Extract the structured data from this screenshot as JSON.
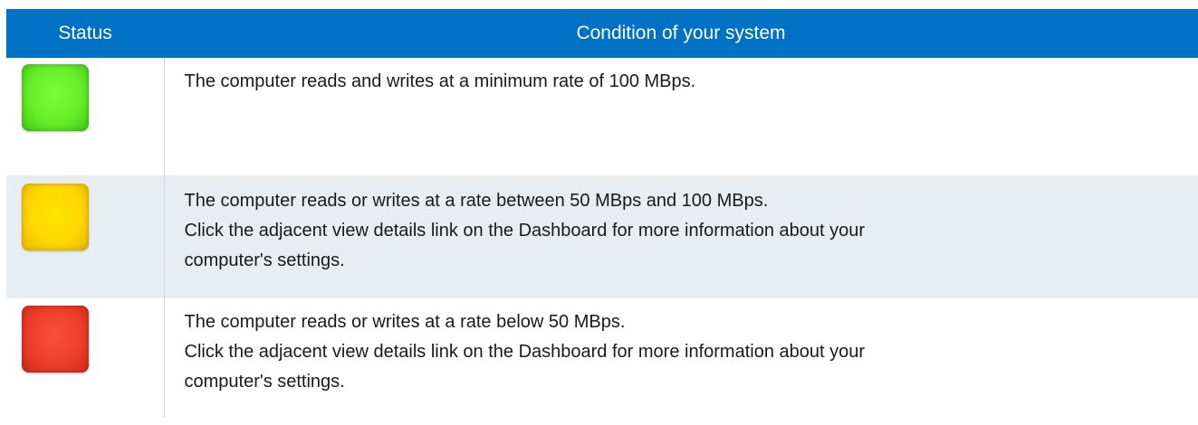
{
  "table": {
    "headers": {
      "status": "Status",
      "condition": "Condition of your system"
    },
    "rows": [
      {
        "status_color": "#66ee2a",
        "status_icon": "green-status-square",
        "lines": [
          "The computer reads and writes at a minimum rate of 100 MBps."
        ]
      },
      {
        "status_color": "#fed700",
        "status_icon": "yellow-status-square",
        "lines": [
          "The computer reads or writes at a rate between 50 MBps and 100 MBps.",
          "Click the adjacent view details link on the Dashboard for more information about your",
          "computer's settings."
        ]
      },
      {
        "status_color": "#ee3e2a",
        "status_icon": "red-status-square",
        "lines": [
          "The computer reads or writes at a rate below 50 MBps.",
          "Click the adjacent view details link on the Dashboard for more information about your",
          "computer's settings."
        ]
      }
    ]
  },
  "colors": {
    "header_background": "#0072c6",
    "header_text": "#ffffff",
    "alternate_row_background": "#e8edf1"
  }
}
